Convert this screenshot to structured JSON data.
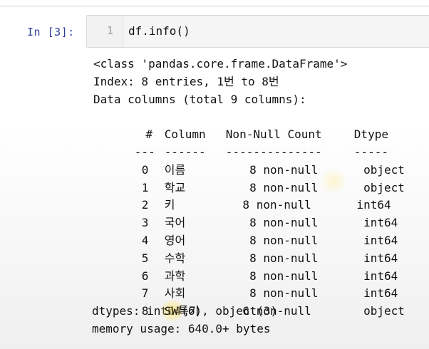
{
  "cell": {
    "prompt": "In [3]:",
    "line_number": "1",
    "code": "df.info()"
  },
  "output": {
    "class_line": "<class 'pandas.core.frame.DataFrame'>",
    "index_line": "Index: 8 entries, 1번 to 8번",
    "columns_line": "Data columns (total 9 columns):",
    "header": {
      "idx": " #",
      "name": "Column",
      "count": "Non-Null Count",
      "dtype": "Dtype"
    },
    "separator": {
      "idx": "---",
      "name": "------",
      "count": "--------------",
      "dtype": "-----"
    },
    "rows": [
      {
        "idx": "0",
        "name": "이름",
        "count": "  8 non-null",
        "dtype": "  object"
      },
      {
        "idx": "1",
        "name": "학교",
        "count": "  8 non-null",
        "dtype": "  object"
      },
      {
        "idx": "2",
        "name": "키",
        "count": " 8 non-null",
        "dtype": " int64"
      },
      {
        "idx": "3",
        "name": "국어",
        "count": "  8 non-null",
        "dtype": "  int64"
      },
      {
        "idx": "4",
        "name": "영어",
        "count": "  8 non-null",
        "dtype": "  int64"
      },
      {
        "idx": "5",
        "name": "수학",
        "count": "  8 non-null",
        "dtype": "  int64"
      },
      {
        "idx": "6",
        "name": "과학",
        "count": "  8 non-null",
        "dtype": "  int64"
      },
      {
        "idx": "7",
        "name": "사회",
        "count": "  8 non-null",
        "dtype": "  int64"
      },
      {
        "idx": "8",
        "name": "SW특기",
        "count": " 6 non-null",
        "dtype": "  object"
      }
    ],
    "dtypes_line": "dtypes: int64(6), object(3)",
    "memory_line": "memory usage: 640.0+ bytes"
  }
}
